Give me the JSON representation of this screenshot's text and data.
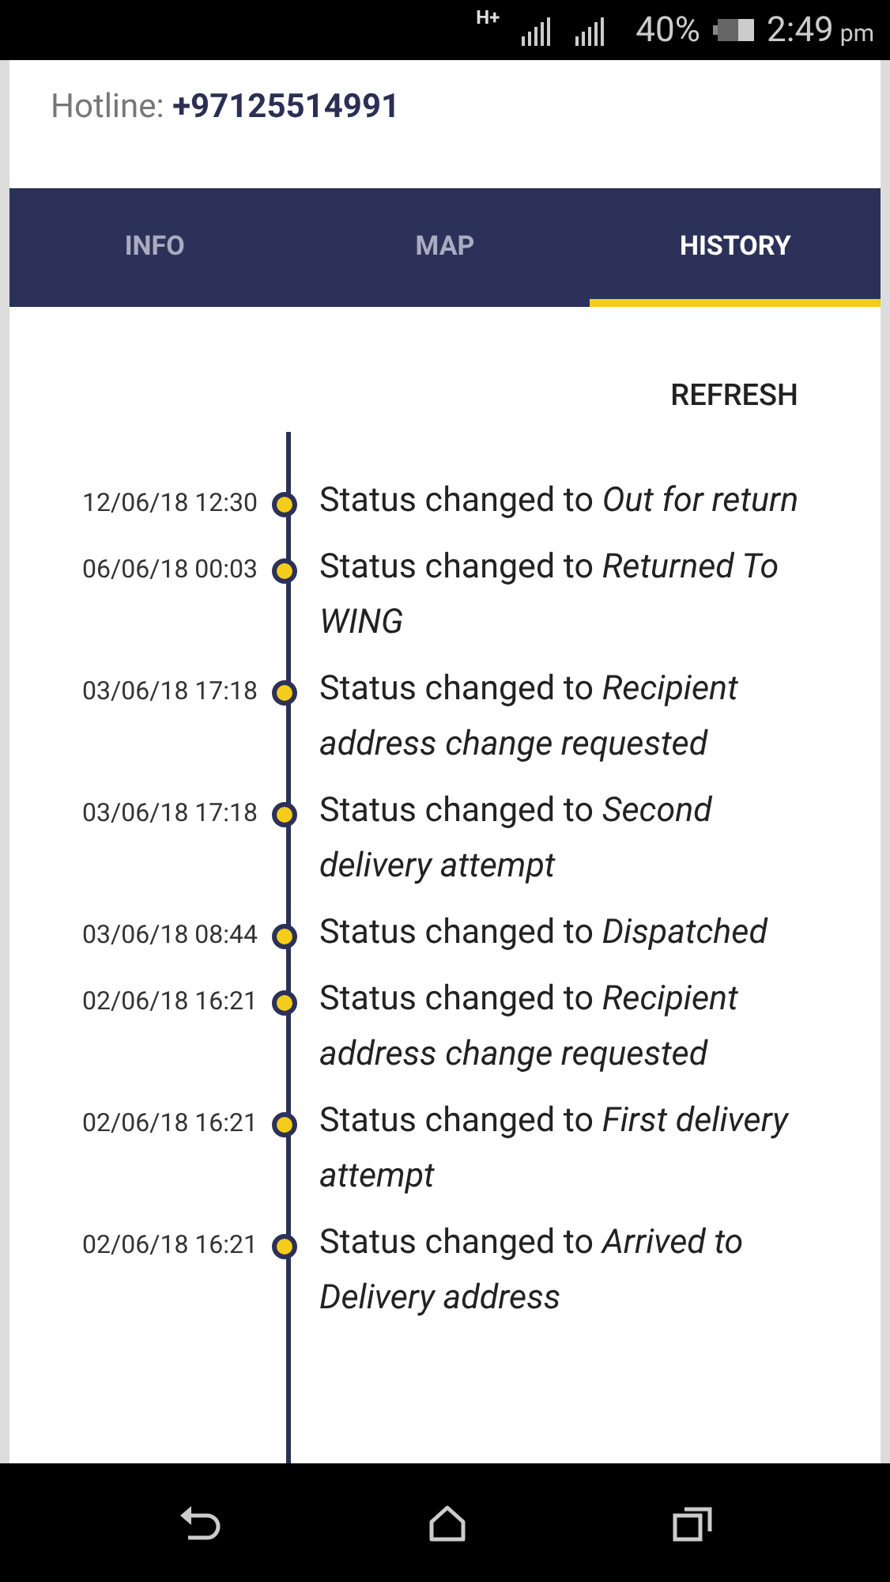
{
  "status_bar": {
    "network": "H+",
    "battery": "40%",
    "time": "2:49",
    "ampm": "pm"
  },
  "hotline": {
    "label": "Hotline:",
    "number": "+97125514991"
  },
  "tabs": [
    {
      "label": "INFO",
      "selected": false
    },
    {
      "label": "MAP",
      "selected": false
    },
    {
      "label": "HISTORY",
      "selected": true
    }
  ],
  "refresh": "REFRESH",
  "history": [
    {
      "time": "12/06/18 12:30",
      "text": "Status changed to *Out for return*"
    },
    {
      "time": "06/06/18 00:03",
      "text": "Status changed to *Returned To WING*"
    },
    {
      "time": "03/06/18 17:18",
      "text": "Status changed to *Recipient address change requested*"
    },
    {
      "time": "03/06/18 17:18",
      "text": "Status changed to *Second delivery attempt*"
    },
    {
      "time": "03/06/18 08:44",
      "text": "Status changed to *Dispatched*"
    },
    {
      "time": "02/06/18 16:21",
      "text": "Status changed to *Recipient address change requested*"
    },
    {
      "time": "02/06/18 16:21",
      "text": "Status changed to *First delivery attempt*"
    },
    {
      "time": "02/06/18 16:21",
      "text": "Status changed to *Arrived to Delivery address*"
    }
  ]
}
